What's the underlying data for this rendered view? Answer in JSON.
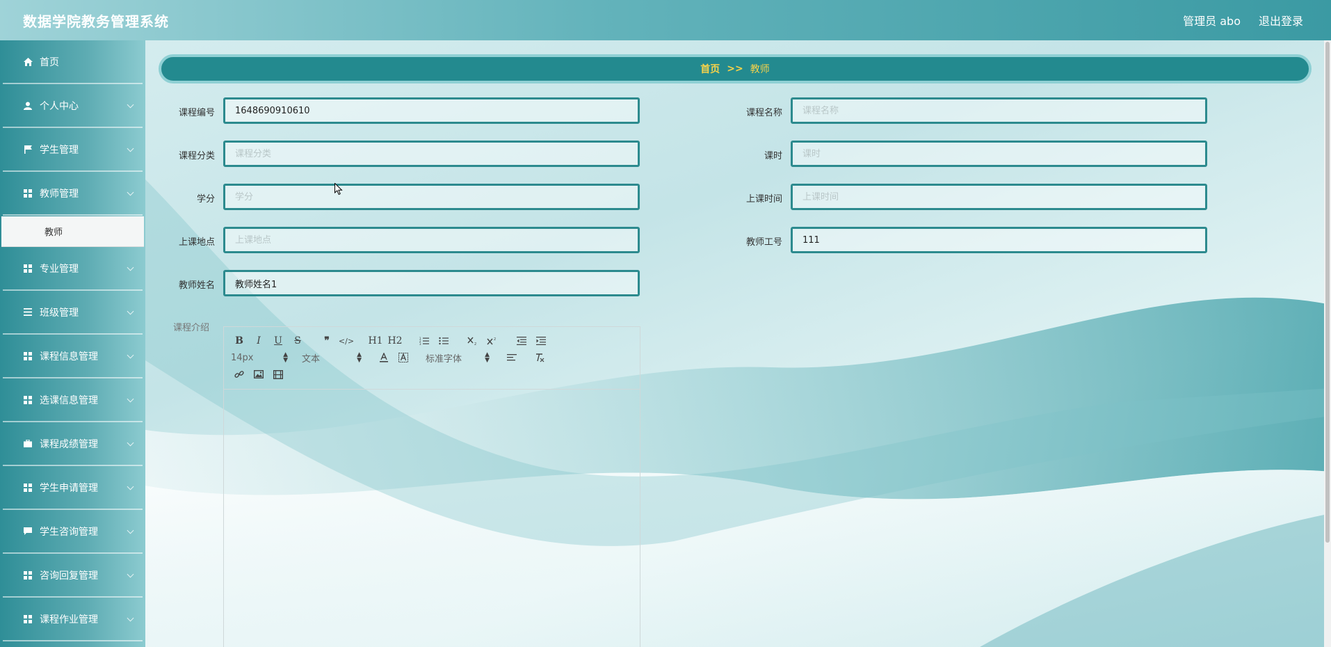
{
  "header": {
    "title": "数据学院教务管理系统",
    "admin": "管理员 abo",
    "logout": "退出登录"
  },
  "sidebar": {
    "items": [
      {
        "label": "首页",
        "icon": "home-icon",
        "chevron": false
      },
      {
        "label": "个人中心",
        "icon": "user-icon",
        "chevron": true
      },
      {
        "label": "学生管理",
        "icon": "flag-icon",
        "chevron": true
      },
      {
        "label": "教师管理",
        "icon": "grid-icon",
        "chevron": true
      },
      {
        "label": "专业管理",
        "icon": "grid-icon",
        "chevron": true
      },
      {
        "label": "班级管理",
        "icon": "list-icon",
        "chevron": true
      },
      {
        "label": "课程信息管理",
        "icon": "grid-icon",
        "chevron": true
      },
      {
        "label": "选课信息管理",
        "icon": "grid-icon",
        "chevron": true
      },
      {
        "label": "课程成绩管理",
        "icon": "briefcase-icon",
        "chevron": true
      },
      {
        "label": "学生申请管理",
        "icon": "grid-icon",
        "chevron": true
      },
      {
        "label": "学生咨询管理",
        "icon": "chat-icon",
        "chevron": true
      },
      {
        "label": "咨询回复管理",
        "icon": "grid-icon",
        "chevron": true
      },
      {
        "label": "课程作业管理",
        "icon": "grid-icon",
        "chevron": true
      }
    ],
    "submenu": {
      "label": "教师",
      "parent_index": 3
    }
  },
  "breadcrumb": {
    "home": "首页",
    "sep": ">>",
    "current": "教师"
  },
  "form": {
    "course_no": {
      "label": "课程编号",
      "value": "1648690910610",
      "placeholder": ""
    },
    "course_name": {
      "label": "课程名称",
      "value": "",
      "placeholder": "课程名称"
    },
    "course_category": {
      "label": "课程分类",
      "value": "",
      "placeholder": "课程分类"
    },
    "hours": {
      "label": "课时",
      "value": "",
      "placeholder": "课时"
    },
    "credit": {
      "label": "学分",
      "value": "",
      "placeholder": "学分"
    },
    "class_time": {
      "label": "上课时间",
      "value": "",
      "placeholder": "上课时间"
    },
    "location": {
      "label": "上课地点",
      "value": "",
      "placeholder": "上课地点"
    },
    "teacher_no": {
      "label": "教师工号",
      "value": "111",
      "placeholder": ""
    },
    "teacher_name": {
      "label": "教师姓名",
      "value": "教师姓名1",
      "placeholder": ""
    },
    "intro": {
      "label": "课程介绍"
    }
  },
  "editor": {
    "font_size": "14px",
    "header_select": "文本",
    "font_select": "标准字体",
    "buttons": [
      "B",
      "I",
      "U",
      "S",
      "❞",
      "</>",
      "H1",
      "H2"
    ]
  },
  "colors": {
    "accent": "#238a8f",
    "breadcrumb_text": "#f6d24a"
  }
}
